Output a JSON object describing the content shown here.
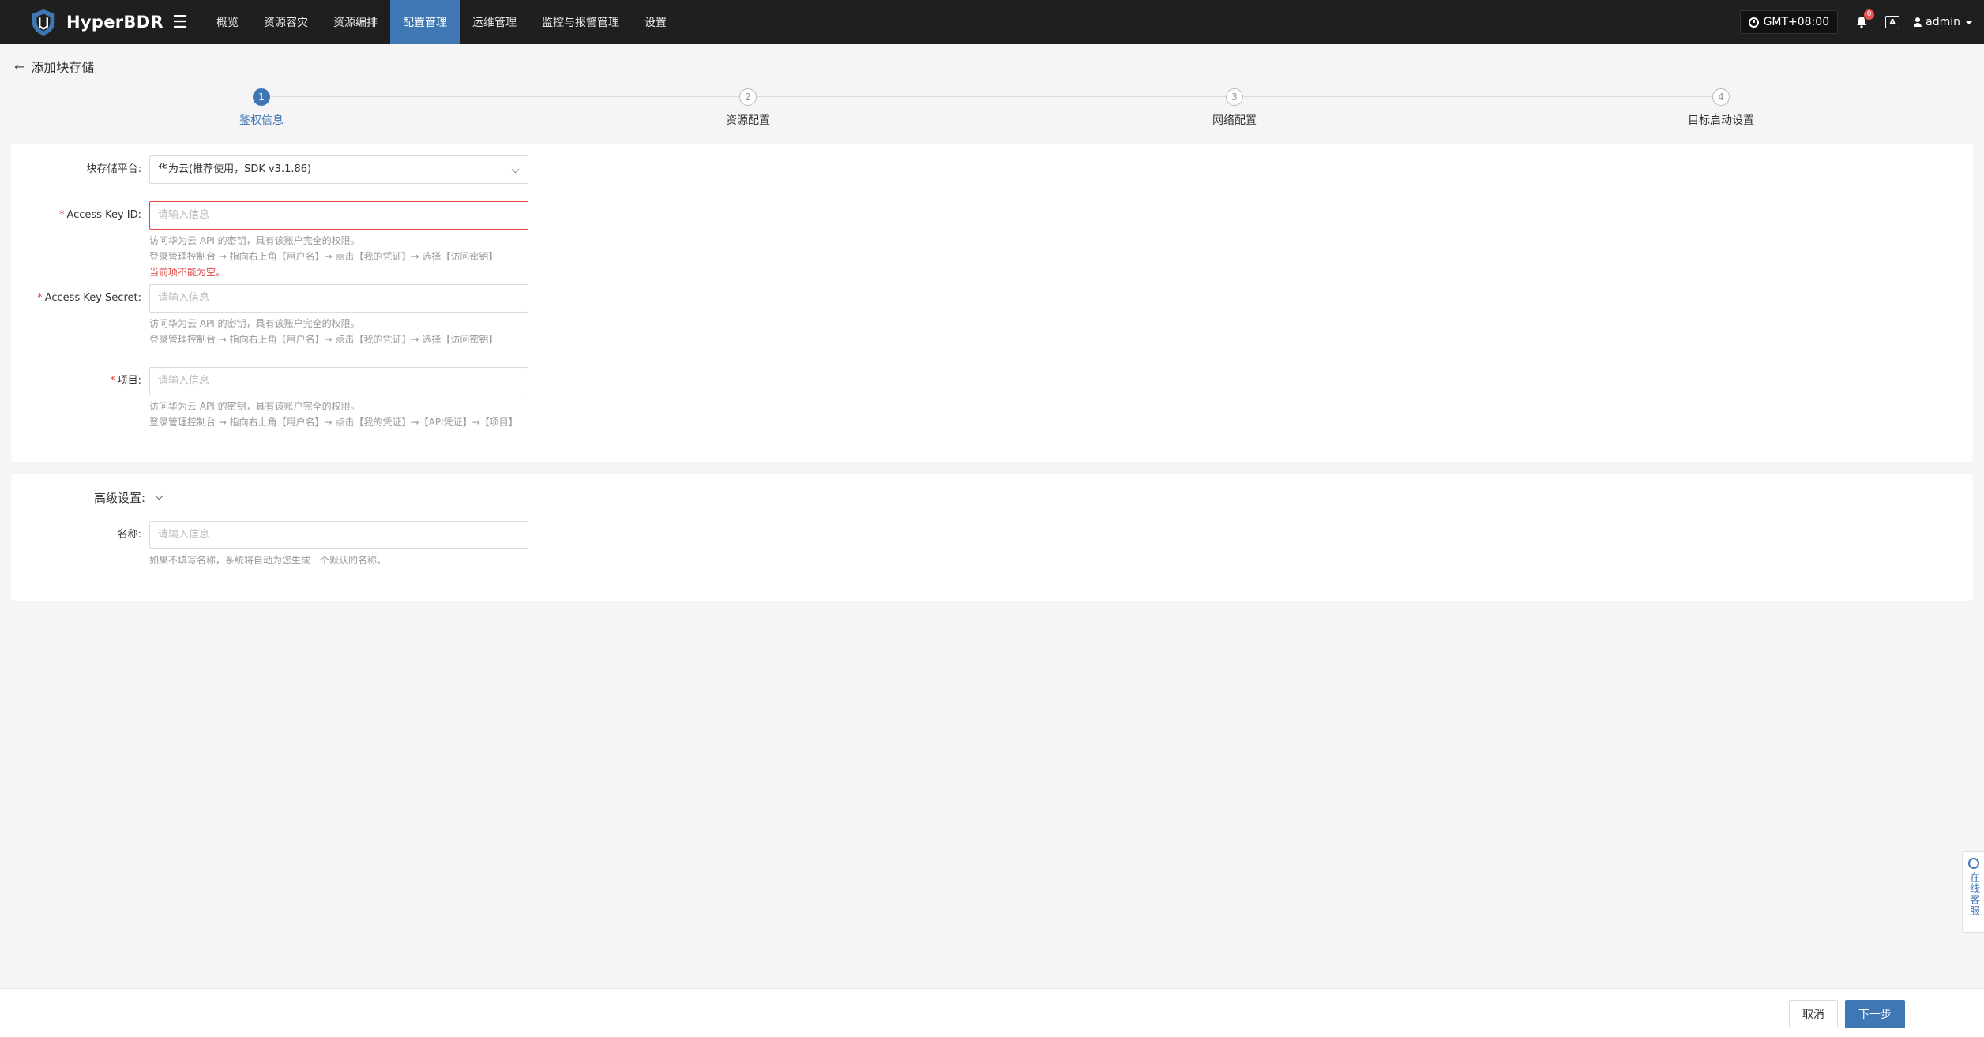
{
  "app": {
    "name": "HyperBDR"
  },
  "nav": {
    "items": [
      {
        "label": "概览",
        "active": false
      },
      {
        "label": "资源容灾",
        "active": false
      },
      {
        "label": "资源编排",
        "active": false
      },
      {
        "label": "配置管理",
        "active": true
      },
      {
        "label": "运维管理",
        "active": false
      },
      {
        "label": "监控与报警管理",
        "active": false
      },
      {
        "label": "设置",
        "active": false
      }
    ]
  },
  "header": {
    "timezone": "GMT+08:00",
    "notification_count": "0",
    "user": "admin"
  },
  "page": {
    "title": "添加块存储"
  },
  "steps": [
    {
      "num": "1",
      "label": "鉴权信息",
      "active": true
    },
    {
      "num": "2",
      "label": "资源配置",
      "active": false
    },
    {
      "num": "3",
      "label": "网络配置",
      "active": false
    },
    {
      "num": "4",
      "label": "目标启动设置",
      "active": false
    }
  ],
  "form": {
    "platform": {
      "label": "块存储平台:",
      "value": "华为云(推荐使用，SDK v3.1.86)"
    },
    "access_key_id": {
      "label": "Access Key ID:",
      "placeholder": "请输入信息",
      "help1": "访问华为云 API 的密钥，具有该账户完全的权限。",
      "help2": "登录管理控制台 → 指向右上角【用户名】→ 点击【我的凭证】→ 选择【访问密钥】",
      "error": "当前项不能为空。"
    },
    "access_key_secret": {
      "label": "Access Key Secret:",
      "placeholder": "请输入信息",
      "help1": "访问华为云 API 的密钥，具有该账户完全的权限。",
      "help2": "登录管理控制台 → 指向右上角【用户名】→ 点击【我的凭证】→ 选择【访问密钥】"
    },
    "project": {
      "label": "项目:",
      "placeholder": "请输入信息",
      "help1": "访问华为云 API 的密钥，具有该账户完全的权限。",
      "help2": "登录管理控制台 → 指向右上角【用户名】→ 点击【我的凭证】→【API凭证】→【项目】"
    }
  },
  "advanced": {
    "title": "高级设置:",
    "name": {
      "label": "名称:",
      "placeholder": "请输入信息",
      "help": "如果不填写名称，系统将自动为您生成一个默认的名称。"
    }
  },
  "footer": {
    "cancel": "取消",
    "next": "下一步"
  },
  "service": {
    "label": "在线客服"
  },
  "colors": {
    "primary": "#3f77b5",
    "topbar": "#1f1f1f",
    "error": "#e04545"
  }
}
